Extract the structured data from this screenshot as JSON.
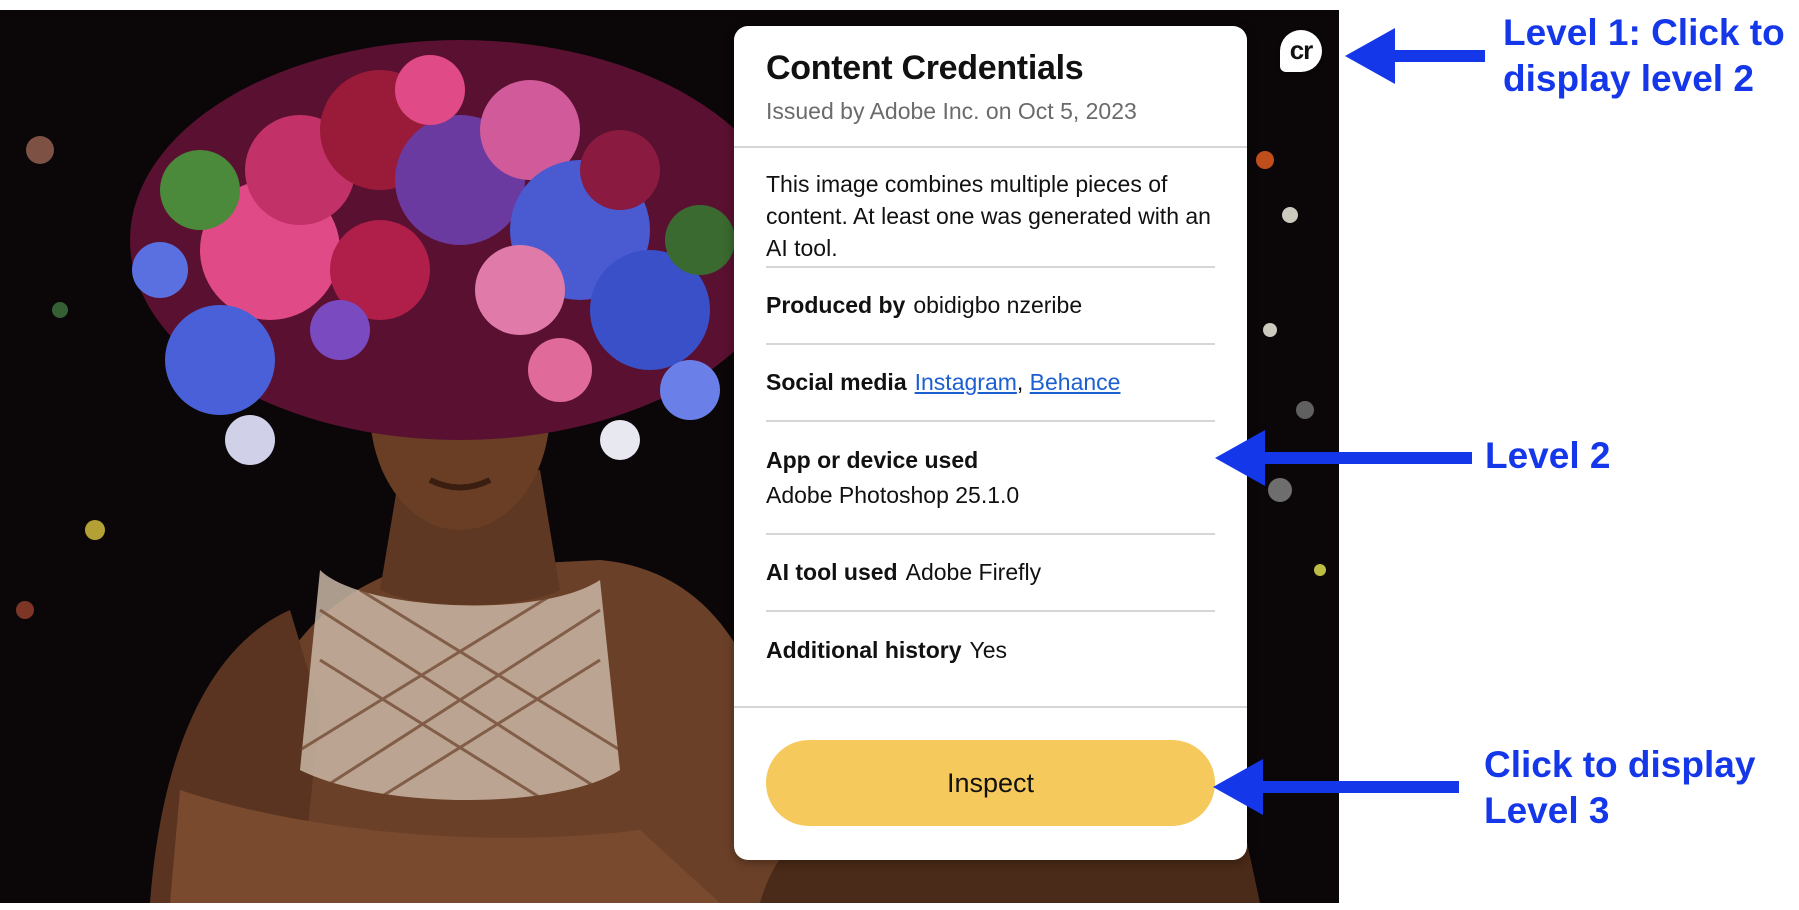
{
  "panel": {
    "title": "Content Credentials",
    "issued": "Issued by Adobe Inc. on Oct 5, 2023",
    "summary": "This image combines multiple pieces of content. At least one was generated with an AI tool.",
    "produced_by": {
      "label": "Produced by",
      "value": "obidigbo nzeribe"
    },
    "social_media": {
      "label": "Social media",
      "links": [
        "Instagram",
        "Behance"
      ],
      "separator": ","
    },
    "app_device": {
      "label": "App or device used",
      "value": "Adobe Photoshop 25.1.0"
    },
    "ai_tool": {
      "label": "AI tool used",
      "value": "Adobe Firefly"
    },
    "additional_history": {
      "label": "Additional history",
      "value": "Yes"
    },
    "inspect_button": "Inspect"
  },
  "cr_badge": {
    "label": "cr",
    "icon": "content-credentials-icon"
  },
  "annotations": {
    "level1": [
      "Level 1: Click to",
      "display level 2"
    ],
    "level2": "Level 2",
    "level3": [
      "Click to display",
      "Level 3"
    ]
  },
  "colors": {
    "annotation": "#1537ea",
    "inspect_button": "#f6c95c",
    "link": "#1b5fd1",
    "photo_background": "#0b0708"
  }
}
